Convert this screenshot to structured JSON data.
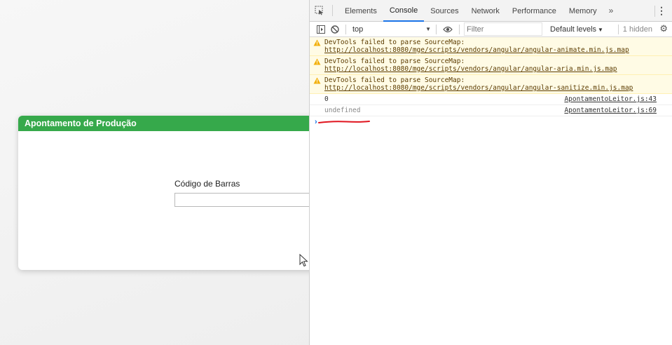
{
  "app": {
    "header_title": "Apontamento de Produção",
    "barcode_label": "Código de Barras",
    "barcode_value": ""
  },
  "devtools": {
    "tabs": [
      {
        "label": "Elements",
        "active": false
      },
      {
        "label": "Console",
        "active": true
      },
      {
        "label": "Sources",
        "active": false
      },
      {
        "label": "Network",
        "active": false
      },
      {
        "label": "Performance",
        "active": false
      },
      {
        "label": "Memory",
        "active": false
      }
    ],
    "overflow_label": "»",
    "menu_label": "⋮",
    "toolbar": {
      "context": "top",
      "filter_placeholder": "Filter",
      "levels": "Default levels",
      "hidden": "1 hidden"
    },
    "messages": [
      {
        "type": "warning",
        "prefix": "DevTools failed to parse SourceMap: ",
        "link": "http://localhost:8080/mge/scripts/vendors/angular/angular-animate.min.js.map"
      },
      {
        "type": "warning",
        "prefix": "DevTools failed to parse SourceMap: ",
        "link": "http://localhost:8080/mge/scripts/vendors/angular/angular-aria.min.js.map"
      },
      {
        "type": "warning",
        "prefix": "DevTools failed to parse SourceMap: ",
        "link": "http://localhost:8080/mge/scripts/vendors/angular/angular-sanitize.min.js.map"
      },
      {
        "type": "log",
        "value": "0",
        "source": "ApontamentoLeitor.js:43"
      },
      {
        "type": "log",
        "value": "undefined",
        "source": "ApontamentoLeitor.js:69"
      }
    ],
    "prompt": "›",
    "colors": {
      "accent": "#1a73e8",
      "annotation": "#e0141e",
      "header_green": "#36a94b"
    }
  }
}
